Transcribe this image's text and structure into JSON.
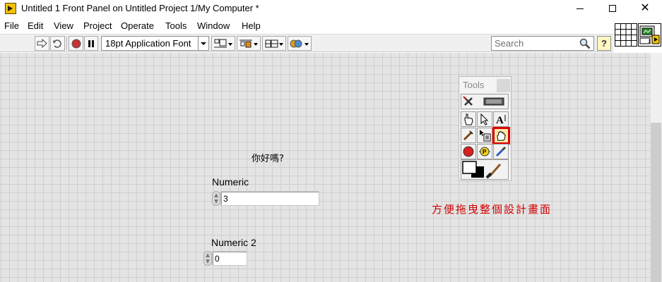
{
  "window": {
    "title": "Untitled 1 Front Panel on Untitled Project 1/My Computer *",
    "close_glyph": "✕"
  },
  "menu": [
    "File",
    "Edit",
    "View",
    "Project",
    "Operate",
    "Tools",
    "Window",
    "Help"
  ],
  "toolbar": {
    "font_selector": "18pt Application Font",
    "search_placeholder": "Search",
    "help_label": "?",
    "buttons": [
      "run-arrow-icon",
      "run-continuously-icon",
      "abort-icon",
      "pause-icon",
      "align-objects-icon",
      "distribute-objects-icon",
      "resize-objects-icon",
      "reorder-icon"
    ]
  },
  "front_panel": {
    "free_label": "你好嗎?",
    "controls": [
      {
        "label": "Numeric",
        "value": "3"
      },
      {
        "label": "Numeric 2",
        "value": "0"
      }
    ]
  },
  "tools_palette": {
    "title": "Tools",
    "tools": [
      "automatic-tool-selection",
      "operate-value-tool",
      "position-select-tool",
      "edit-text-tool",
      "connect-wire-tool",
      "object-shortcut-menu-tool",
      "scroll-window-tool",
      "set-breakpoint-tool",
      "probe-data-tool",
      "get-color-tool",
      "set-color-tool"
    ],
    "selected": "scroll-window-tool"
  },
  "annotation": {
    "text": "方便拖曳整個設計畫面",
    "color": "#d40000"
  },
  "colors": {
    "panel_background": "#e4e4e4",
    "grid_line": "#cfcfcf",
    "highlight": "#e00000"
  }
}
